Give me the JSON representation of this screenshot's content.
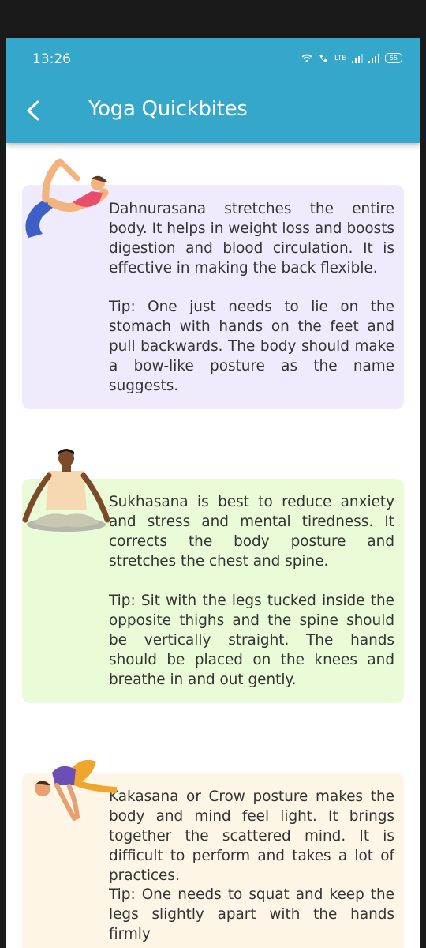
{
  "status_bar": {
    "time": "13:26",
    "network_label": "LTE",
    "battery": "55"
  },
  "app_bar": {
    "title": "Yoga Quickbites",
    "back_icon": "chevron-left-icon"
  },
  "cards": [
    {
      "pose_icon": "bow-pose-illustration",
      "color": "#efebfd",
      "description": "Dahnurasana stretches the entire body. It helps in weight loss and boosts digestion and blood circulation. It is effective in making the back flexible.",
      "tip": "Tip: One just needs to lie on the stomach with hands on the feet and pull backwards. The body should make a bow-like posture as the name suggests."
    },
    {
      "pose_icon": "easy-pose-illustration",
      "color": "#e9fbd7",
      "description": "Sukhasana is best to reduce anxiety and stress and mental tiredness. It corrects the body posture and stretches the chest and spine.",
      "tip": "Tip: Sit with the legs tucked inside the opposite thighs and the spine should be vertically straight. The hands should be placed on the knees and breathe in and out gently."
    },
    {
      "pose_icon": "crow-pose-illustration",
      "color": "#fdf6e6",
      "description": "Kakasana or Crow posture makes the body and mind feel light. It brings together the scattered mind. It is difficult to perform and takes a lot of practices.",
      "tip": "Tip: One needs to squat and keep the legs slightly apart with the hands firmly"
    }
  ]
}
